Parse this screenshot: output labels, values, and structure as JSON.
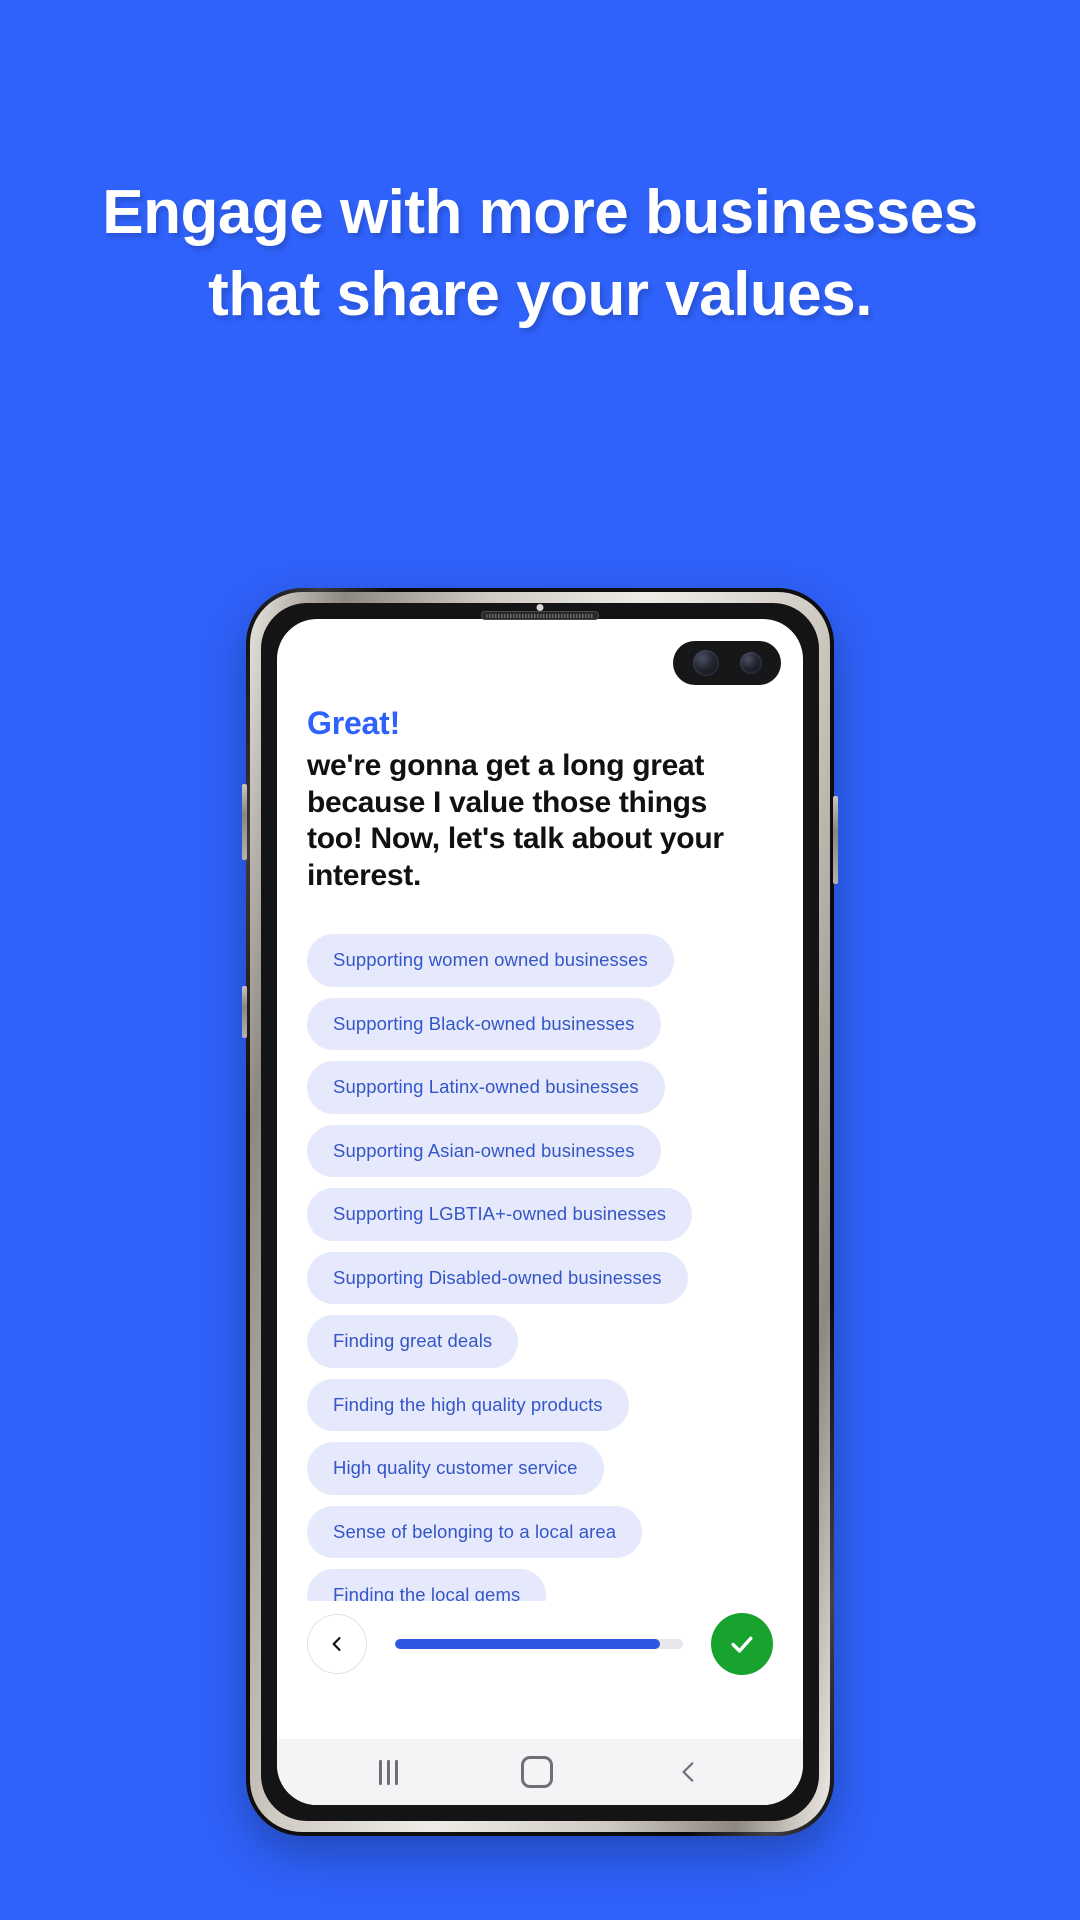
{
  "page": {
    "background_color": "#2f62fb",
    "headline": "Engage with more businesses that share your values."
  },
  "phone": {
    "screen": {
      "greeting": "Great!",
      "paragraph": "we're gonna get a long great because I value those things too! Now, let's talk about your interest.",
      "chips": [
        {
          "label": "Supporting women owned businesses"
        },
        {
          "label": "Supporting Black-owned businesses"
        },
        {
          "label": "Supporting Latinx-owned businesses"
        },
        {
          "label": "Supporting Asian-owned businesses"
        },
        {
          "label": "Supporting LGBTIA+-owned businesses"
        },
        {
          "label": "Supporting Disabled-owned businesses"
        },
        {
          "label": "Finding great deals"
        },
        {
          "label": "Finding the high quality products"
        },
        {
          "label": "High quality customer service"
        },
        {
          "label": "Sense of belonging to a local area"
        },
        {
          "label": "Finding the local gems"
        }
      ],
      "chip_background_color": "#e6e9fb",
      "chip_text_color": "#3456c8",
      "accent_color": "#2f62fb",
      "bottom_bar": {
        "back_icon": "chevron-left-icon",
        "progress_percent": 92,
        "progress_fill_color": "#2f56e0",
        "progress_track_color": "#e8e8ec",
        "confirm_icon": "check-icon",
        "confirm_color": "#17a32d"
      },
      "nav_bar": {
        "recent_icon": "recent-apps-icon",
        "home_icon": "home-square-icon",
        "back_icon": "back-chevron-icon"
      }
    },
    "hardware": {
      "camera_icon": "dual-camera-punch-hole",
      "earpiece_icon": "earpiece-speaker-icon"
    }
  }
}
